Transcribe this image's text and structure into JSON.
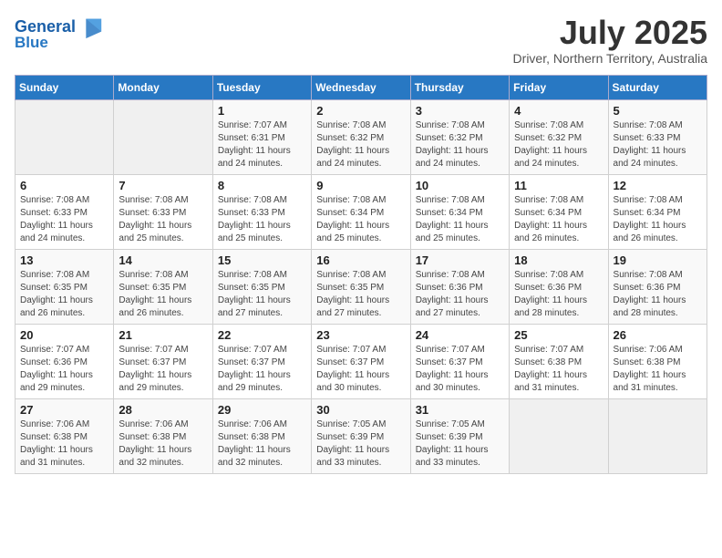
{
  "header": {
    "logo_line1": "General",
    "logo_line2": "Blue",
    "month": "July 2025",
    "location": "Driver, Northern Territory, Australia"
  },
  "weekdays": [
    "Sunday",
    "Monday",
    "Tuesday",
    "Wednesday",
    "Thursday",
    "Friday",
    "Saturday"
  ],
  "weeks": [
    [
      {
        "day": "",
        "sunrise": "",
        "sunset": "",
        "daylight": ""
      },
      {
        "day": "",
        "sunrise": "",
        "sunset": "",
        "daylight": ""
      },
      {
        "day": "1",
        "sunrise": "Sunrise: 7:07 AM",
        "sunset": "Sunset: 6:31 PM",
        "daylight": "Daylight: 11 hours and 24 minutes."
      },
      {
        "day": "2",
        "sunrise": "Sunrise: 7:08 AM",
        "sunset": "Sunset: 6:32 PM",
        "daylight": "Daylight: 11 hours and 24 minutes."
      },
      {
        "day": "3",
        "sunrise": "Sunrise: 7:08 AM",
        "sunset": "Sunset: 6:32 PM",
        "daylight": "Daylight: 11 hours and 24 minutes."
      },
      {
        "day": "4",
        "sunrise": "Sunrise: 7:08 AM",
        "sunset": "Sunset: 6:32 PM",
        "daylight": "Daylight: 11 hours and 24 minutes."
      },
      {
        "day": "5",
        "sunrise": "Sunrise: 7:08 AM",
        "sunset": "Sunset: 6:33 PM",
        "daylight": "Daylight: 11 hours and 24 minutes."
      }
    ],
    [
      {
        "day": "6",
        "sunrise": "Sunrise: 7:08 AM",
        "sunset": "Sunset: 6:33 PM",
        "daylight": "Daylight: 11 hours and 24 minutes."
      },
      {
        "day": "7",
        "sunrise": "Sunrise: 7:08 AM",
        "sunset": "Sunset: 6:33 PM",
        "daylight": "Daylight: 11 hours and 25 minutes."
      },
      {
        "day": "8",
        "sunrise": "Sunrise: 7:08 AM",
        "sunset": "Sunset: 6:33 PM",
        "daylight": "Daylight: 11 hours and 25 minutes."
      },
      {
        "day": "9",
        "sunrise": "Sunrise: 7:08 AM",
        "sunset": "Sunset: 6:34 PM",
        "daylight": "Daylight: 11 hours and 25 minutes."
      },
      {
        "day": "10",
        "sunrise": "Sunrise: 7:08 AM",
        "sunset": "Sunset: 6:34 PM",
        "daylight": "Daylight: 11 hours and 25 minutes."
      },
      {
        "day": "11",
        "sunrise": "Sunrise: 7:08 AM",
        "sunset": "Sunset: 6:34 PM",
        "daylight": "Daylight: 11 hours and 26 minutes."
      },
      {
        "day": "12",
        "sunrise": "Sunrise: 7:08 AM",
        "sunset": "Sunset: 6:34 PM",
        "daylight": "Daylight: 11 hours and 26 minutes."
      }
    ],
    [
      {
        "day": "13",
        "sunrise": "Sunrise: 7:08 AM",
        "sunset": "Sunset: 6:35 PM",
        "daylight": "Daylight: 11 hours and 26 minutes."
      },
      {
        "day": "14",
        "sunrise": "Sunrise: 7:08 AM",
        "sunset": "Sunset: 6:35 PM",
        "daylight": "Daylight: 11 hours and 26 minutes."
      },
      {
        "day": "15",
        "sunrise": "Sunrise: 7:08 AM",
        "sunset": "Sunset: 6:35 PM",
        "daylight": "Daylight: 11 hours and 27 minutes."
      },
      {
        "day": "16",
        "sunrise": "Sunrise: 7:08 AM",
        "sunset": "Sunset: 6:35 PM",
        "daylight": "Daylight: 11 hours and 27 minutes."
      },
      {
        "day": "17",
        "sunrise": "Sunrise: 7:08 AM",
        "sunset": "Sunset: 6:36 PM",
        "daylight": "Daylight: 11 hours and 27 minutes."
      },
      {
        "day": "18",
        "sunrise": "Sunrise: 7:08 AM",
        "sunset": "Sunset: 6:36 PM",
        "daylight": "Daylight: 11 hours and 28 minutes."
      },
      {
        "day": "19",
        "sunrise": "Sunrise: 7:08 AM",
        "sunset": "Sunset: 6:36 PM",
        "daylight": "Daylight: 11 hours and 28 minutes."
      }
    ],
    [
      {
        "day": "20",
        "sunrise": "Sunrise: 7:07 AM",
        "sunset": "Sunset: 6:36 PM",
        "daylight": "Daylight: 11 hours and 29 minutes."
      },
      {
        "day": "21",
        "sunrise": "Sunrise: 7:07 AM",
        "sunset": "Sunset: 6:37 PM",
        "daylight": "Daylight: 11 hours and 29 minutes."
      },
      {
        "day": "22",
        "sunrise": "Sunrise: 7:07 AM",
        "sunset": "Sunset: 6:37 PM",
        "daylight": "Daylight: 11 hours and 29 minutes."
      },
      {
        "day": "23",
        "sunrise": "Sunrise: 7:07 AM",
        "sunset": "Sunset: 6:37 PM",
        "daylight": "Daylight: 11 hours and 30 minutes."
      },
      {
        "day": "24",
        "sunrise": "Sunrise: 7:07 AM",
        "sunset": "Sunset: 6:37 PM",
        "daylight": "Daylight: 11 hours and 30 minutes."
      },
      {
        "day": "25",
        "sunrise": "Sunrise: 7:07 AM",
        "sunset": "Sunset: 6:38 PM",
        "daylight": "Daylight: 11 hours and 31 minutes."
      },
      {
        "day": "26",
        "sunrise": "Sunrise: 7:06 AM",
        "sunset": "Sunset: 6:38 PM",
        "daylight": "Daylight: 11 hours and 31 minutes."
      }
    ],
    [
      {
        "day": "27",
        "sunrise": "Sunrise: 7:06 AM",
        "sunset": "Sunset: 6:38 PM",
        "daylight": "Daylight: 11 hours and 31 minutes."
      },
      {
        "day": "28",
        "sunrise": "Sunrise: 7:06 AM",
        "sunset": "Sunset: 6:38 PM",
        "daylight": "Daylight: 11 hours and 32 minutes."
      },
      {
        "day": "29",
        "sunrise": "Sunrise: 7:06 AM",
        "sunset": "Sunset: 6:38 PM",
        "daylight": "Daylight: 11 hours and 32 minutes."
      },
      {
        "day": "30",
        "sunrise": "Sunrise: 7:05 AM",
        "sunset": "Sunset: 6:39 PM",
        "daylight": "Daylight: 11 hours and 33 minutes."
      },
      {
        "day": "31",
        "sunrise": "Sunrise: 7:05 AM",
        "sunset": "Sunset: 6:39 PM",
        "daylight": "Daylight: 11 hours and 33 minutes."
      },
      {
        "day": "",
        "sunrise": "",
        "sunset": "",
        "daylight": ""
      },
      {
        "day": "",
        "sunrise": "",
        "sunset": "",
        "daylight": ""
      }
    ]
  ]
}
